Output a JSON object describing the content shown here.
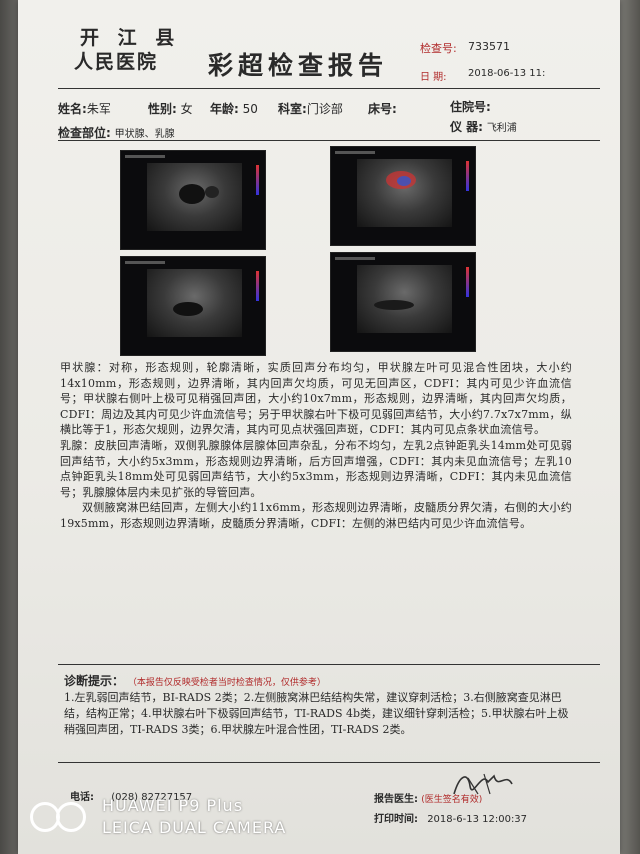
{
  "header": {
    "hospital_line1": "开 江 县",
    "hospital_line2": "人民医院",
    "title": "彩超检查报告",
    "exam_no_label": "检查号:",
    "exam_no": "733571",
    "date_label": "日    期:",
    "date": "2018-06-13 11:"
  },
  "patient": {
    "name_label": "姓名:",
    "name": "朱军",
    "sex_label": "性别:",
    "sex": "女",
    "age_label": "年龄:",
    "age": "50",
    "dept_label": "科室:",
    "dept": "门诊部",
    "bed_label": "床号:",
    "bed": "",
    "inpatient_label": "住院号:",
    "inpatient": "",
    "part_label": "检查部位:",
    "part": "甲状腺、乳腺",
    "device_label": "仪    器:",
    "device": "飞利浦"
  },
  "findings": [
    "甲状腺：对称，形态规则，轮廓清晰，实质回声分布均匀，甲状腺左叶可见混合性团块，大小约14x10mm，形态规则，边界清晰，其内回声欠均质，可见无回声区，CDFI：其内可见少许血流信号；甲状腺右侧叶上极可见稍强回声团，大小约10x7mm，形态规则，边界清晰，其内回声欠均质，CDFI：周边及其内可见少许血流信号；另于甲状腺右叶下极可见弱回声结节，大小约7.7x7x7mm，纵横比等于1，形态欠规则，边界欠清，其内可见点状强回声斑，CDFI：其内可见点条状血流信号。",
    "乳腺：皮肤回声清晰，双侧乳腺腺体层腺体回声杂乱，分布不均匀，左乳2点钟距乳头14mm处可见弱回声结节，大小约5x3mm，形态规则边界清晰，后方回声增强，CDFI：其内未见血流信号；左乳10点钟距乳头18mm处可见弱回声结节，大小约5x3mm，形态规则边界清晰，CDFI：其内未见血流信号；乳腺腺体层内未见扩张的导管回声。",
    "双侧腋窝淋巴结回声，左侧大小约11x6mm，形态规则边界清晰，皮髓质分界欠清，右侧的大小约19x5mm，形态规则边界清晰，皮髓质分界清晰，CDFI：左侧的淋巴结内可见少许血流信号。"
  ],
  "diagnosis": {
    "label": "诊断提示：",
    "note": "（本报告仅反映受检者当时检查情况，仅供参考）",
    "text": "1.左乳弱回声结节，BI-RADS 2类；2.左侧腋窝淋巴结结构失常，建议穿刺活检；3.右侧腋窝查见淋巴结，结构正常；4.甲状腺右叶下极弱回声结节，TI-RADS 4b类，建议细针穿刺活检；5.甲状腺右叶上极稍强回声团，TI-RADS 3类；6.甲状腺左叶混合性团，TI-RADS 2类。"
  },
  "footer": {
    "phone_label": "电话:",
    "phone": "(028) 82727157",
    "doctor_label": "报告医生:",
    "doctor_note": "(医生签名有效)",
    "print_label": "打印时间:",
    "print_time": "2018-6-13  12:00:37"
  },
  "watermark": {
    "line1": "HUAWEI P9 Plus",
    "line2": "LEICA DUAL CAMERA"
  },
  "colors": {
    "accent_red": "#b02a2a",
    "paper": "#eeede8"
  }
}
